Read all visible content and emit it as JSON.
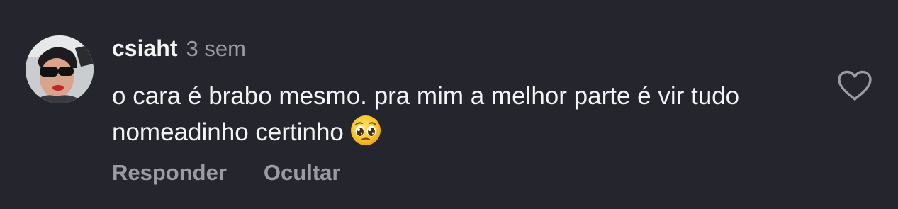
{
  "comment": {
    "username": "csiaht",
    "timestamp": "3 sem",
    "text": "o cara é brabo mesmo. pra mim a melhor parte é vir tudo nomeadinho certinho",
    "emoji": "pleading-face",
    "actions": {
      "reply_label": "Responder",
      "hide_label": "Ocultar"
    },
    "like_icon": "heart-outline-icon"
  },
  "colors": {
    "background": "#25262d",
    "primary_text": "#f4f4f6",
    "secondary_text": "#9a9ca4"
  }
}
